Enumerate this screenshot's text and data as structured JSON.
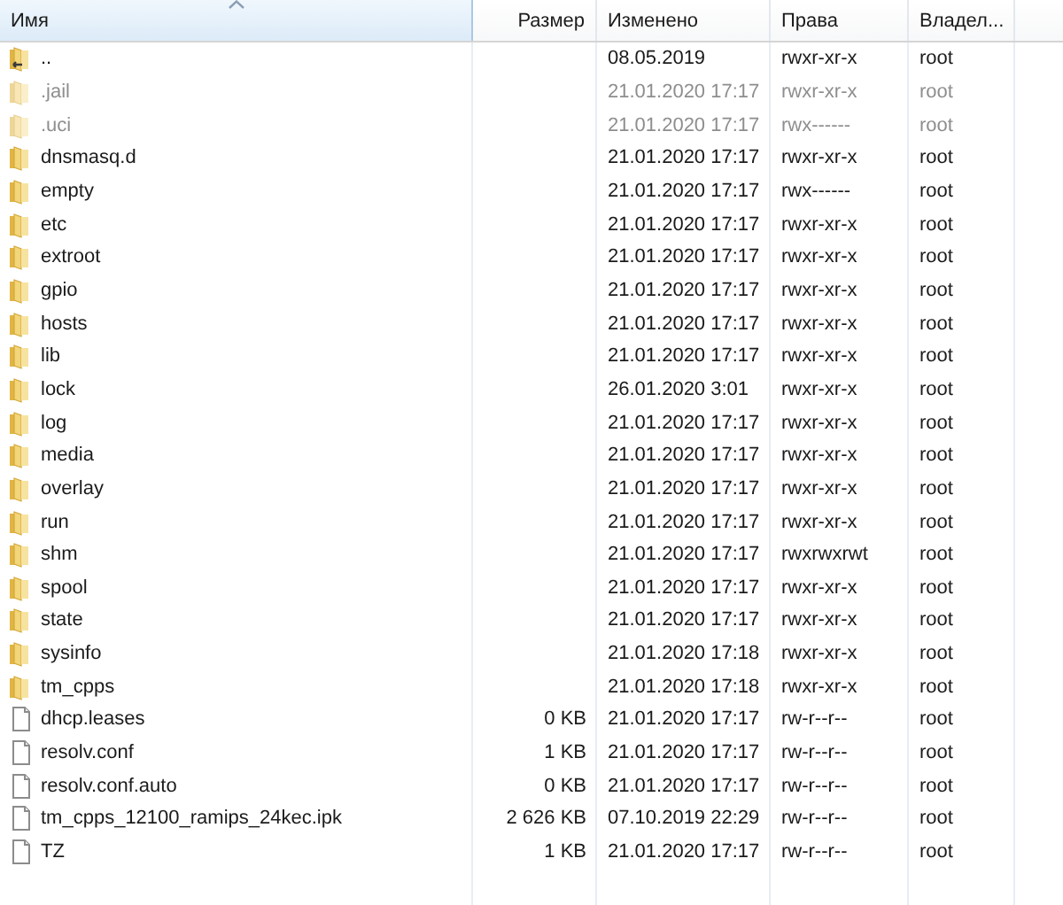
{
  "table": {
    "columns": [
      {
        "label": "Имя",
        "sorted": true
      },
      {
        "label": "Размер",
        "sorted": false
      },
      {
        "label": "Изменено",
        "sorted": false
      },
      {
        "label": "Права",
        "sorted": false
      },
      {
        "label": "Владел...",
        "sorted": false
      }
    ],
    "rows": [
      {
        "kind": "parent",
        "name": "..",
        "modified": "08.05.2019",
        "rights": "rwxr-xr-x",
        "owner": "root",
        "hidden": false
      },
      {
        "kind": "folder",
        "name": ".jail",
        "modified": "21.01.2020 17:17",
        "rights": "rwxr-xr-x",
        "owner": "root",
        "hidden": true
      },
      {
        "kind": "folder",
        "name": ".uci",
        "modified": "21.01.2020 17:17",
        "rights": "rwx------",
        "owner": "root",
        "hidden": true
      },
      {
        "kind": "folder",
        "name": "dnsmasq.d",
        "modified": "21.01.2020 17:17",
        "rights": "rwxr-xr-x",
        "owner": "root",
        "hidden": false
      },
      {
        "kind": "folder",
        "name": "empty",
        "modified": "21.01.2020 17:17",
        "rights": "rwx------",
        "owner": "root",
        "hidden": false
      },
      {
        "kind": "folder",
        "name": "etc",
        "modified": "21.01.2020 17:17",
        "rights": "rwxr-xr-x",
        "owner": "root",
        "hidden": false
      },
      {
        "kind": "folder",
        "name": "extroot",
        "modified": "21.01.2020 17:17",
        "rights": "rwxr-xr-x",
        "owner": "root",
        "hidden": false
      },
      {
        "kind": "folder",
        "name": "gpio",
        "modified": "21.01.2020 17:17",
        "rights": "rwxr-xr-x",
        "owner": "root",
        "hidden": false
      },
      {
        "kind": "folder",
        "name": "hosts",
        "modified": "21.01.2020 17:17",
        "rights": "rwxr-xr-x",
        "owner": "root",
        "hidden": false
      },
      {
        "kind": "folder",
        "name": "lib",
        "modified": "21.01.2020 17:17",
        "rights": "rwxr-xr-x",
        "owner": "root",
        "hidden": false
      },
      {
        "kind": "folder",
        "name": "lock",
        "modified": "26.01.2020 3:01",
        "rights": "rwxr-xr-x",
        "owner": "root",
        "hidden": false
      },
      {
        "kind": "folder",
        "name": "log",
        "modified": "21.01.2020 17:17",
        "rights": "rwxr-xr-x",
        "owner": "root",
        "hidden": false
      },
      {
        "kind": "folder",
        "name": "media",
        "modified": "21.01.2020 17:17",
        "rights": "rwxr-xr-x",
        "owner": "root",
        "hidden": false
      },
      {
        "kind": "folder",
        "name": "overlay",
        "modified": "21.01.2020 17:17",
        "rights": "rwxr-xr-x",
        "owner": "root",
        "hidden": false
      },
      {
        "kind": "folder",
        "name": "run",
        "modified": "21.01.2020 17:17",
        "rights": "rwxr-xr-x",
        "owner": "root",
        "hidden": false
      },
      {
        "kind": "folder",
        "name": "shm",
        "modified": "21.01.2020 17:17",
        "rights": "rwxrwxrwt",
        "owner": "root",
        "hidden": false
      },
      {
        "kind": "folder",
        "name": "spool",
        "modified": "21.01.2020 17:17",
        "rights": "rwxr-xr-x",
        "owner": "root",
        "hidden": false
      },
      {
        "kind": "folder",
        "name": "state",
        "modified": "21.01.2020 17:17",
        "rights": "rwxr-xr-x",
        "owner": "root",
        "hidden": false
      },
      {
        "kind": "folder",
        "name": "sysinfo",
        "modified": "21.01.2020 17:18",
        "rights": "rwxr-xr-x",
        "owner": "root",
        "hidden": false
      },
      {
        "kind": "folder",
        "name": "tm_cpps",
        "modified": "21.01.2020 17:18",
        "rights": "rwxr-xr-x",
        "owner": "root",
        "hidden": false
      },
      {
        "kind": "file",
        "name": "dhcp.leases",
        "size": "0 KB",
        "modified": "21.01.2020 17:17",
        "rights": "rw-r--r--",
        "owner": "root",
        "hidden": false
      },
      {
        "kind": "file",
        "name": "resolv.conf",
        "size": "1 KB",
        "modified": "21.01.2020 17:17",
        "rights": "rw-r--r--",
        "owner": "root",
        "hidden": false
      },
      {
        "kind": "file",
        "name": "resolv.conf.auto",
        "size": "0 KB",
        "modified": "21.01.2020 17:17",
        "rights": "rw-r--r--",
        "owner": "root",
        "hidden": false
      },
      {
        "kind": "file",
        "name": "tm_cpps_12100_ramips_24kec.ipk",
        "size": "2 626 KB",
        "modified": "07.10.2019 22:29",
        "rights": "rw-r--r--",
        "owner": "root",
        "hidden": false
      },
      {
        "kind": "file",
        "name": "TZ",
        "size": "1 KB",
        "modified": "21.01.2020 17:17",
        "rights": "rw-r--r--",
        "owner": "root",
        "hidden": false
      }
    ]
  }
}
